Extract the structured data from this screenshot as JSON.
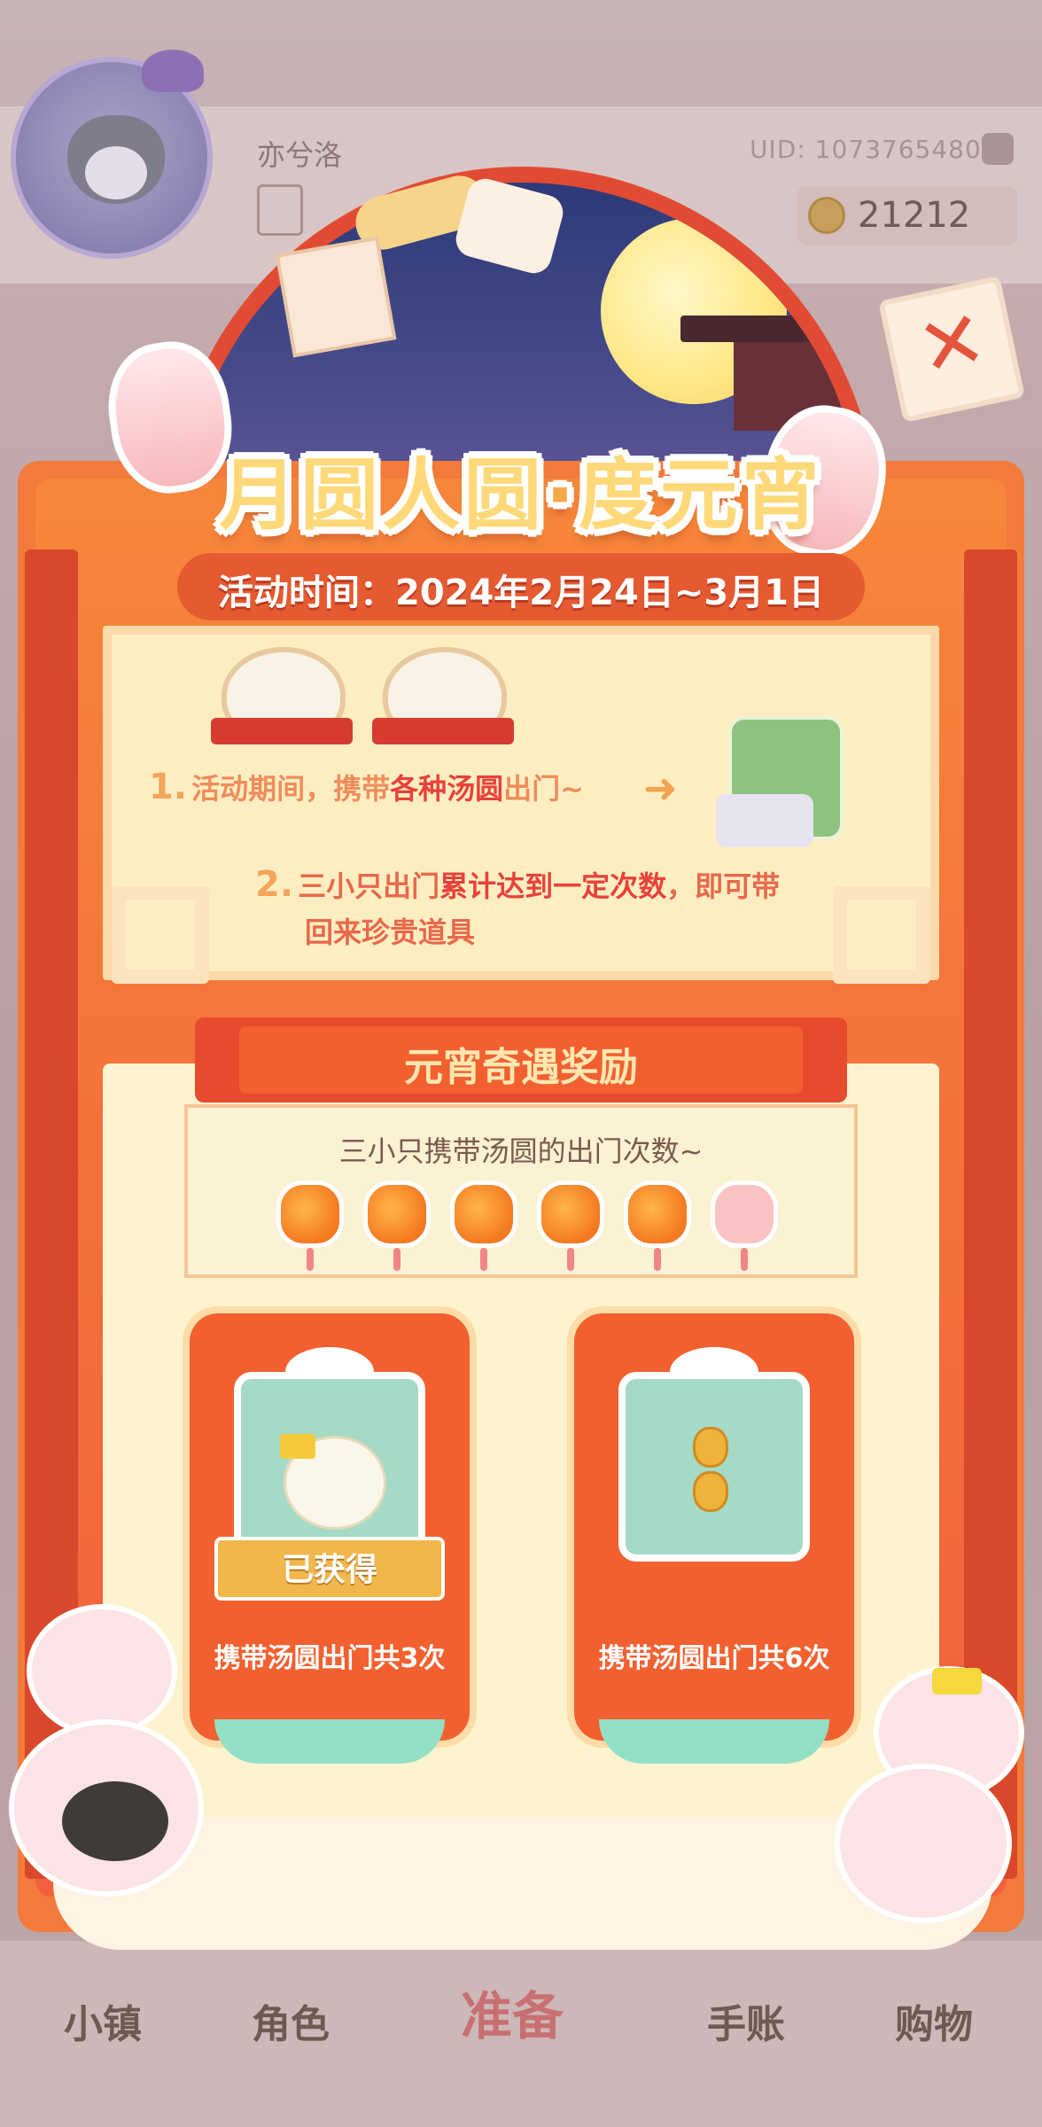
{
  "profile": {
    "username": "亦兮洛",
    "uid": "UID: 1073765480",
    "coins": "21212"
  },
  "bottom_nav": [
    {
      "label": "小镇"
    },
    {
      "label": "角色"
    },
    {
      "label": "准备"
    },
    {
      "label": "手账"
    },
    {
      "label": "购物"
    }
  ],
  "event": {
    "title_left": "月圆人圆",
    "title_dot": "·",
    "title_right": "度元宵",
    "time": "活动时间：2024年2月24日~3月1日",
    "rules": {
      "rule1_num": "1.",
      "rule1_a": "活动期间，携带",
      "rule1_hl": "各种汤圆",
      "rule1_b": "出门~",
      "rule2_num": "2.",
      "rule2_a": "三小只出门",
      "rule2_hl": "累计达到一定次数",
      "rule2_b": "，即可带",
      "rule2_c": "回来珍贵道具"
    },
    "rewards": {
      "title": "元宵奇遇奖励",
      "counter_label": "三小只携带汤圆的出门次数~",
      "progress_lit": 5,
      "progress_total": 6,
      "items": [
        {
          "label": "携带汤圆出门共3次",
          "status": "已获得"
        },
        {
          "label": "携带汤圆出门共6次",
          "status": ""
        }
      ]
    }
  },
  "colors": {
    "panel": "#f27a3a",
    "accent_red": "#e8413a",
    "gift_teal": "#a4dac6",
    "lantern_lit": "#f47a22",
    "lantern_off": "#f9c3c4"
  },
  "icons": {
    "close": "close-x-icon",
    "coin": "coin-icon",
    "calendar": "calendar-icon",
    "uid_copy": "copy-icon"
  }
}
